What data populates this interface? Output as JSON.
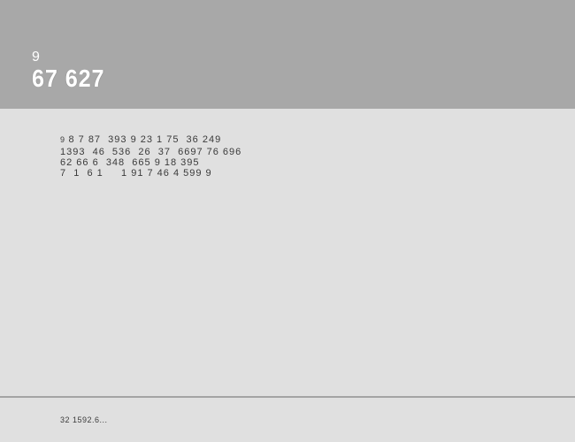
{
  "header": {
    "small": "9",
    "large": "67  627"
  },
  "content": {
    "small": "9",
    "inline": "8 7 87  393 9 23 1 75  36 249",
    "lines": [
      "1393  46  536  26  37  6697 76 696",
      "62 66 6  348  665 9 18 395",
      "7  1  6 1     1 91 7 46 4 599 9"
    ]
  },
  "footer": {
    "text": "32 1592.6..."
  }
}
